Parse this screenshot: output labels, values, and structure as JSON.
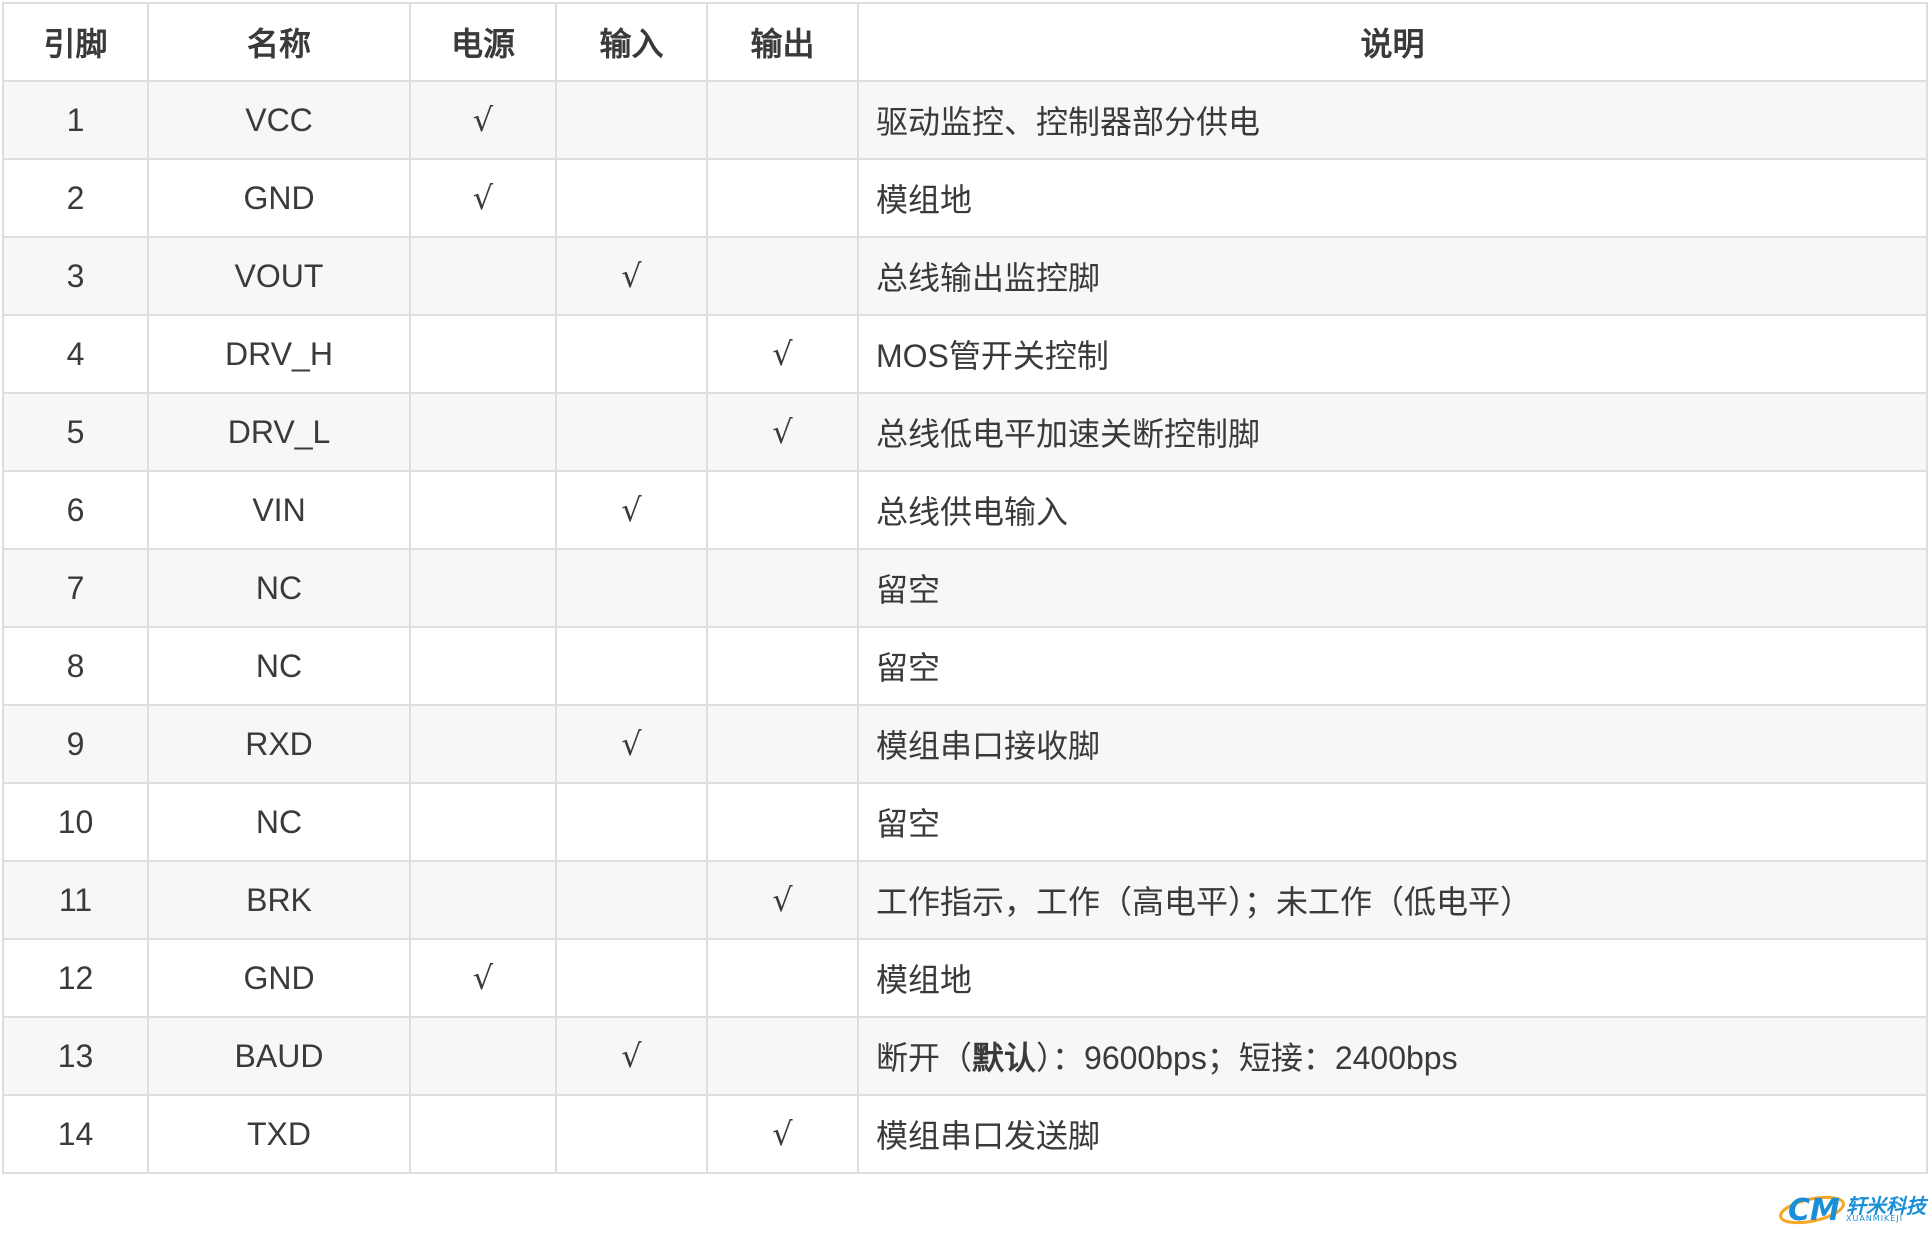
{
  "table": {
    "headers": [
      "引脚",
      "名称",
      "电源",
      "输入",
      "输出",
      "说明"
    ],
    "rows": [
      {
        "pin": "1",
        "name": "VCC",
        "power": "√",
        "input": "",
        "output": "",
        "desc": "驱动监控、控制器部分供电"
      },
      {
        "pin": "2",
        "name": "GND",
        "power": "√",
        "input": "",
        "output": "",
        "desc": "模组地"
      },
      {
        "pin": "3",
        "name": "VOUT",
        "power": "",
        "input": "√",
        "output": "",
        "desc": "总线输出监控脚"
      },
      {
        "pin": "4",
        "name": "DRV_H",
        "power": "",
        "input": "",
        "output": "√",
        "desc": "MOS管开关控制"
      },
      {
        "pin": "5",
        "name": "DRV_L",
        "power": "",
        "input": "",
        "output": "√",
        "desc": "总线低电平加速关断控制脚"
      },
      {
        "pin": "6",
        "name": "VIN",
        "power": "",
        "input": "√",
        "output": "",
        "desc": "总线供电输入"
      },
      {
        "pin": "7",
        "name": "NC",
        "power": "",
        "input": "",
        "output": "",
        "desc": "留空"
      },
      {
        "pin": "8",
        "name": "NC",
        "power": "",
        "input": "",
        "output": "",
        "desc": "留空"
      },
      {
        "pin": "9",
        "name": "RXD",
        "power": "",
        "input": "√",
        "output": "",
        "desc": "模组串口接收脚"
      },
      {
        "pin": "10",
        "name": "NC",
        "power": "",
        "input": "",
        "output": "",
        "desc": "留空"
      },
      {
        "pin": "11",
        "name": "BRK",
        "power": "",
        "input": "",
        "output": "√",
        "desc": "工作指示，工作（高电平）；未工作（低电平）"
      },
      {
        "pin": "12",
        "name": "GND",
        "power": "√",
        "input": "",
        "output": "",
        "desc": "模组地"
      },
      {
        "pin": "13",
        "name": "BAUD",
        "power": "",
        "input": "√",
        "output": "",
        "desc_parts": [
          "断开（",
          "默认",
          "）：9600bps；短接：2400bps"
        ]
      },
      {
        "pin": "14",
        "name": "TXD",
        "power": "",
        "input": "",
        "output": "√",
        "desc": "模组串口发送脚"
      }
    ]
  },
  "logo": {
    "text": "轩米科技",
    "sub": "XUANMIKEJI",
    "primary_color": "#1a8fd6",
    "accent_color": "#f5a623"
  }
}
